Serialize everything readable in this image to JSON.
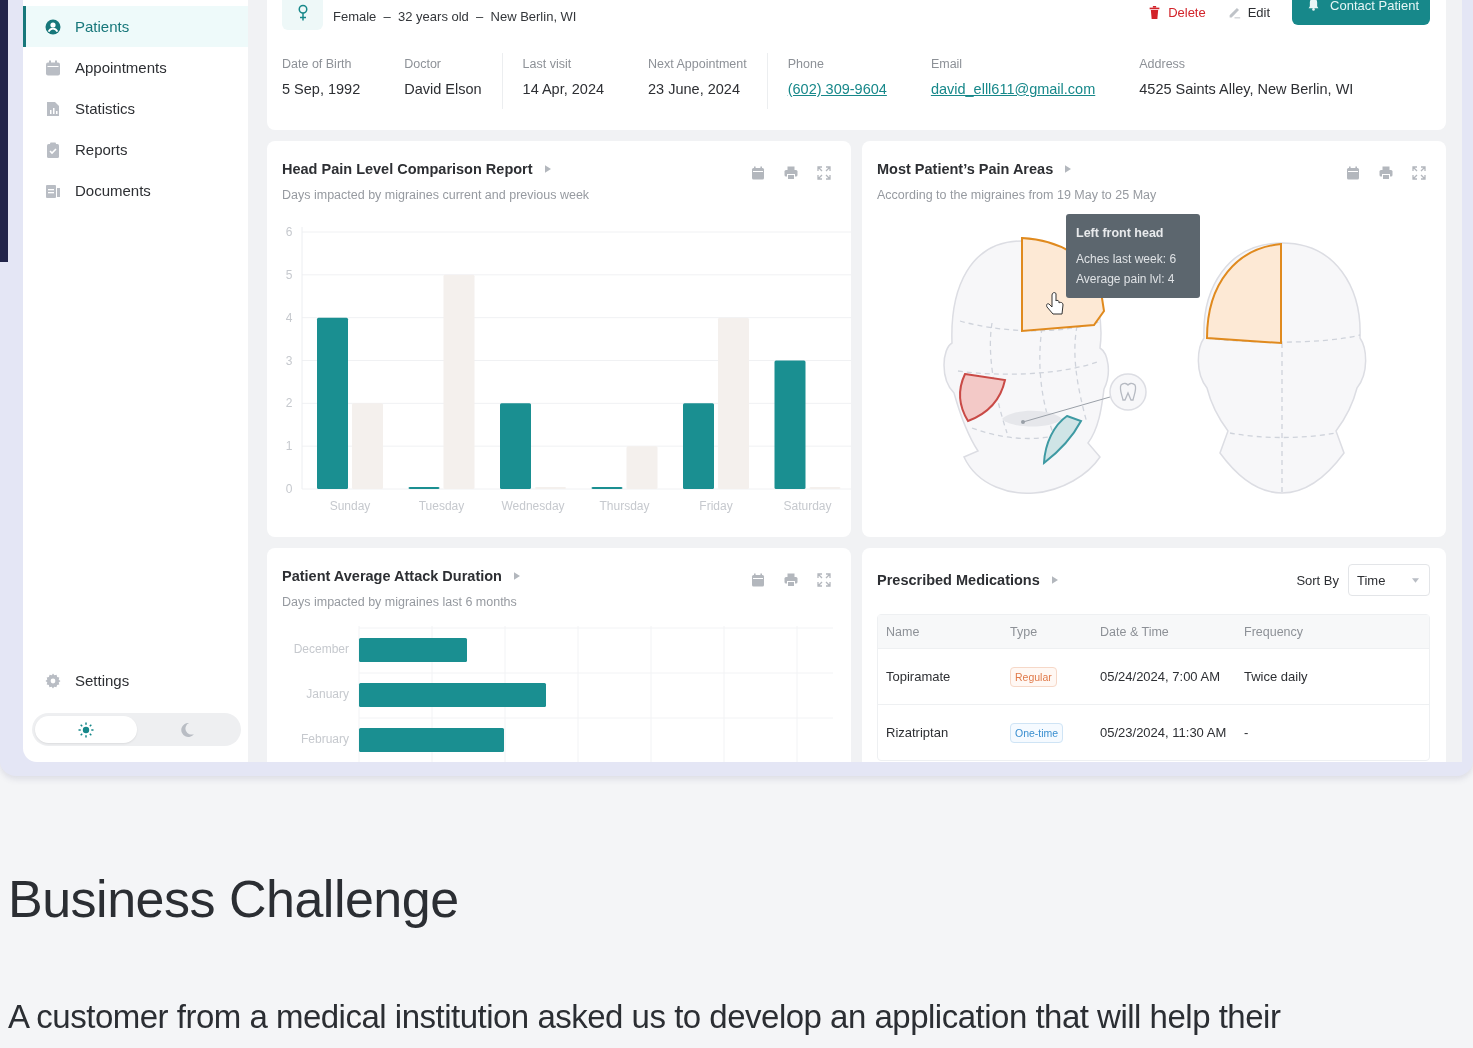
{
  "sidebar": {
    "items": [
      {
        "label": "Patients",
        "selected": true
      },
      {
        "label": "Appointments",
        "selected": false
      },
      {
        "label": "Statistics",
        "selected": false
      },
      {
        "label": "Reports",
        "selected": false
      },
      {
        "label": "Documents",
        "selected": false
      }
    ],
    "settings": {
      "label": "Settings"
    },
    "theme_toggle": [
      {
        "kind": "light",
        "selected": true
      },
      {
        "kind": "dark",
        "selected": false
      }
    ]
  },
  "patient": {
    "subtitle": "Female  –  32 years old  –  New Berlin, WI",
    "actions": [
      {
        "kind": "delete",
        "label": "Delete"
      },
      {
        "kind": "edit",
        "label": "Edit"
      },
      {
        "kind": "contact",
        "label": "Contact Patient"
      }
    ],
    "details": [
      {
        "items": [
          {
            "label": "Date of Birth",
            "value": "5 Sep, 1992",
            "link": false
          },
          {
            "label": "Doctor",
            "value": "David Elson",
            "link": false
          }
        ]
      },
      {
        "items": [
          {
            "label": "Last visit",
            "value": "14 Apr, 2024",
            "link": false
          },
          {
            "label": "Next Appointment",
            "value": "23 June, 2024",
            "link": false
          }
        ]
      },
      {
        "items": [
          {
            "label": "Phone",
            "value": "(602) 309-9604",
            "link": true
          },
          {
            "label": "Email",
            "value": "david_elll611@gmail.com",
            "link": true
          },
          {
            "label": "Address",
            "value": "4525 Saints Alley, New Berlin, WI",
            "link": false
          }
        ]
      }
    ]
  },
  "pain_report": {
    "title": "Head Pain Level Comparison Report",
    "subtitle": "Days impacted by migraines current and previous week",
    "chart_data": {
      "type": "bar",
      "categories": [
        "Sunday",
        "Tuesday",
        "Wednesday",
        "Thursday",
        "Friday",
        "Saturday"
      ],
      "series": [
        {
          "color": "#1a8f91",
          "values": [
            4,
            0,
            2,
            0,
            2,
            3
          ]
        },
        {
          "color": "#f4f0ed",
          "values": [
            2,
            5,
            0,
            1,
            4,
            0
          ]
        }
      ],
      "ylim": [
        0,
        6
      ],
      "yticks": [
        0,
        1,
        2,
        3,
        4,
        5,
        6
      ],
      "grid": true
    }
  },
  "pain_areas": {
    "title": "Most Patient’s Pain Areas",
    "subtitle": "According to the migraines from 19 May to 25 May",
    "tooltip": {
      "title": "Left front head",
      "lines": [
        "Aches last week: 6",
        "Average pain lvl: 4"
      ]
    }
  },
  "attack_duration": {
    "title": "Patient Average Attack Duration",
    "subtitle": "Days impacted by migraines last 6 months",
    "bar_labels": [
      "December",
      "January",
      "February"
    ]
  },
  "medications": {
    "title": "Prescribed Medications",
    "sort": {
      "label": "Sort By",
      "value": "Time"
    },
    "columns": [
      "Name",
      "Type",
      "Date & Time",
      "Frequency"
    ],
    "rows": [
      {
        "name": "Topiramate",
        "type": {
          "label": "Regular",
          "kind": "regular"
        },
        "datetime": "05/24/2024, 7:00 AM",
        "frequency": "Twice daily"
      },
      {
        "name": "Rizatriptan",
        "type": {
          "label": "One-time",
          "kind": "one_time"
        },
        "datetime": "05/23/2024, 11:30 AM",
        "frequency": "-"
      }
    ]
  },
  "article": {
    "heading": "Business Challenge",
    "paragraph": "A customer from a medical institution asked us to develop an application that will help their"
  }
}
